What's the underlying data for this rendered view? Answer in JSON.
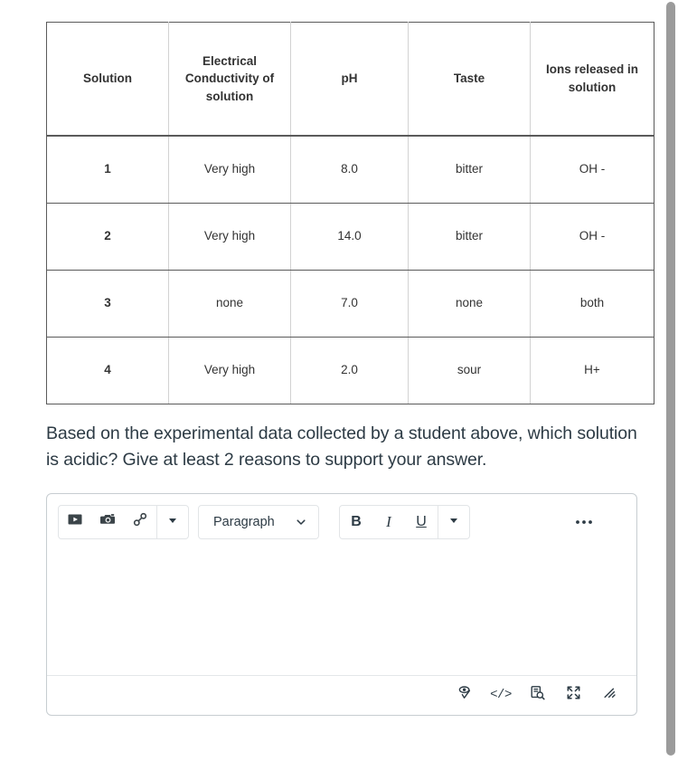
{
  "table": {
    "headers": [
      "Solution",
      "Electrical Conductivity of solution",
      "pH",
      "Taste",
      "Ions released in solution"
    ],
    "rows": [
      {
        "solution": "1",
        "conductivity": "Very high",
        "ph": "8.0",
        "taste": "bitter",
        "ions": "OH -"
      },
      {
        "solution": "2",
        "conductivity": "Very high",
        "ph": "14.0",
        "taste": "bitter",
        "ions": "OH -"
      },
      {
        "solution": "3",
        "conductivity": "none",
        "ph": "7.0",
        "taste": "none",
        "ions": "both"
      },
      {
        "solution": "4",
        "conductivity": "Very high",
        "ph": "2.0",
        "taste": "sour",
        "ions": "H+"
      }
    ]
  },
  "question": {
    "text": "Based on the experimental data collected by a student above, which solution is acidic? Give at least 2 reasons to support your answer."
  },
  "editor": {
    "toolbar": {
      "insert_media_label": "Insert media",
      "insert_image_label": "Insert image",
      "insert_link_label": "Insert link",
      "insert_more_label": "More insert options",
      "paragraph_style": "Paragraph",
      "bold_label": "B",
      "italic_label": "I",
      "underline_label": "U",
      "format_more_label": "More formatting options",
      "overflow_label": "•••"
    },
    "body": {
      "value": "",
      "placeholder": ""
    },
    "statusbar": {
      "accessibility_checker_label": "Accessibility Checker",
      "html_editor_label": "</>",
      "word_count_label": "Word Count",
      "fullscreen_label": "Fullscreen",
      "resize_label": "Resize"
    }
  },
  "colors": {
    "page_background": "#ffffff",
    "text": "#2d3b45",
    "table_text": "#333333",
    "table_border": "#5a5a5a",
    "table_inner_border": "#d2d2d2",
    "editor_border": "#c7cdd1",
    "scrollbar_thumb": "#9b9b9b"
  }
}
